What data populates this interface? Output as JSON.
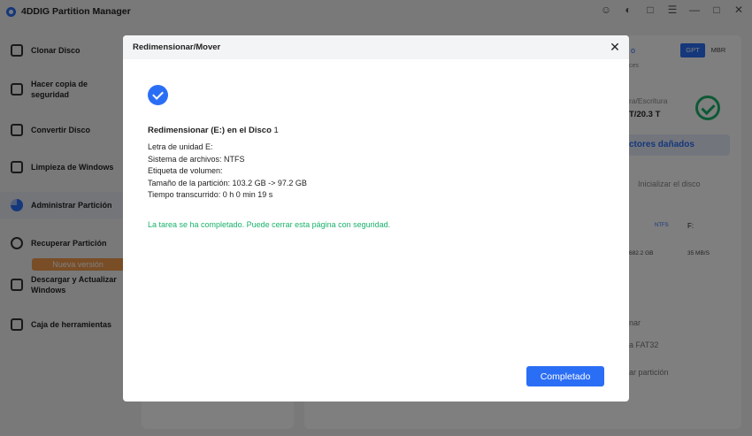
{
  "app": {
    "title": "4DDIG Partition Manager"
  },
  "sidebar": {
    "items": [
      {
        "label": "Clonar Disco"
      },
      {
        "label": "Hacer copia de seguridad"
      },
      {
        "label": "Convertir Disco"
      },
      {
        "label": "Limpieza de Windows"
      },
      {
        "label": "Administrar Partición"
      },
      {
        "label": "Recuperar Partición"
      },
      {
        "label": "Descargar y Actualizar Windows"
      },
      {
        "label": "Caja de herramientas"
      }
    ],
    "new_badge": "Nueva versión"
  },
  "background": {
    "partition_style_gpt": "GPT",
    "partition_style_mbr": "MBR",
    "frag_o": "o",
    "frag_ces": "ces",
    "read_write_label": "ra/Escritura",
    "read_write_value": "T/20.3 T",
    "bad_sectors": "ctores dañados",
    "init_disk": "Inicializar el disco",
    "fs_badge": "NTFS",
    "drive_letter": "F:",
    "size_value": "682.2 GB",
    "speed_value": "35 MB/S",
    "menu_1": "nar",
    "menu_2": "a FAT32",
    "menu_3": "ar partición"
  },
  "modal": {
    "title": "Redimensionar/Mover",
    "heading_bold": "Redimensionar (E:) en el Disco",
    "heading_disk": "1",
    "lines": [
      "Letra de unidad E:",
      "Sistema de archivos: NTFS",
      "Etiqueta de volumen:",
      "Tamaño de la partición: 103.2 GB -> 97.2 GB",
      "Tiempo transcurrido: 0 h 0 min 19 s"
    ],
    "success_message": "La tarea se ha completado. Puede cerrar esta página con seguridad.",
    "complete_button": "Completado"
  },
  "colors": {
    "accent": "#2b6ef6",
    "success": "#1ab26b",
    "badge": "#f39a4c"
  }
}
